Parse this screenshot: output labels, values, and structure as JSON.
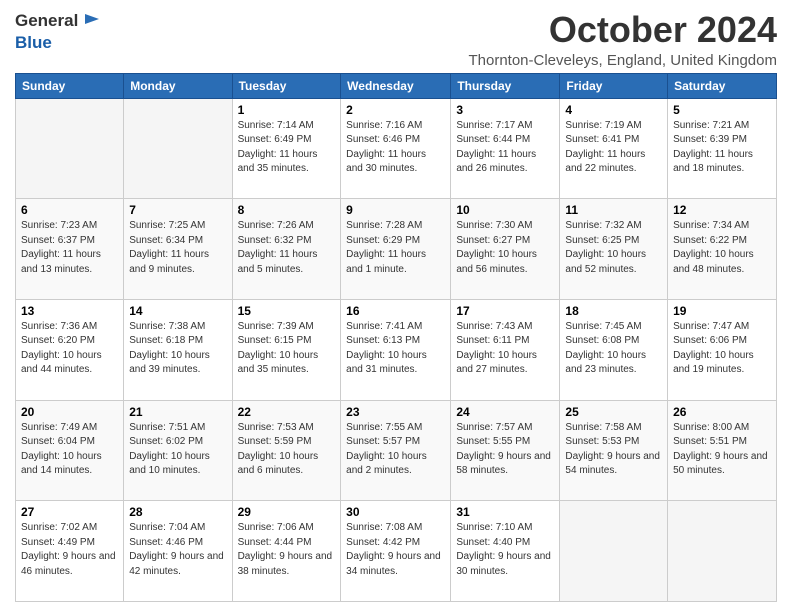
{
  "logo": {
    "line1": "General",
    "line2": "Blue"
  },
  "title": "October 2024",
  "location": "Thornton-Cleveleys, England, United Kingdom",
  "days_of_week": [
    "Sunday",
    "Monday",
    "Tuesday",
    "Wednesday",
    "Thursday",
    "Friday",
    "Saturday"
  ],
  "weeks": [
    [
      {
        "day": "",
        "info": ""
      },
      {
        "day": "",
        "info": ""
      },
      {
        "day": "1",
        "info": "Sunrise: 7:14 AM\nSunset: 6:49 PM\nDaylight: 11 hours and 35 minutes."
      },
      {
        "day": "2",
        "info": "Sunrise: 7:16 AM\nSunset: 6:46 PM\nDaylight: 11 hours and 30 minutes."
      },
      {
        "day": "3",
        "info": "Sunrise: 7:17 AM\nSunset: 6:44 PM\nDaylight: 11 hours and 26 minutes."
      },
      {
        "day": "4",
        "info": "Sunrise: 7:19 AM\nSunset: 6:41 PM\nDaylight: 11 hours and 22 minutes."
      },
      {
        "day": "5",
        "info": "Sunrise: 7:21 AM\nSunset: 6:39 PM\nDaylight: 11 hours and 18 minutes."
      }
    ],
    [
      {
        "day": "6",
        "info": "Sunrise: 7:23 AM\nSunset: 6:37 PM\nDaylight: 11 hours and 13 minutes."
      },
      {
        "day": "7",
        "info": "Sunrise: 7:25 AM\nSunset: 6:34 PM\nDaylight: 11 hours and 9 minutes."
      },
      {
        "day": "8",
        "info": "Sunrise: 7:26 AM\nSunset: 6:32 PM\nDaylight: 11 hours and 5 minutes."
      },
      {
        "day": "9",
        "info": "Sunrise: 7:28 AM\nSunset: 6:29 PM\nDaylight: 11 hours and 1 minute."
      },
      {
        "day": "10",
        "info": "Sunrise: 7:30 AM\nSunset: 6:27 PM\nDaylight: 10 hours and 56 minutes."
      },
      {
        "day": "11",
        "info": "Sunrise: 7:32 AM\nSunset: 6:25 PM\nDaylight: 10 hours and 52 minutes."
      },
      {
        "day": "12",
        "info": "Sunrise: 7:34 AM\nSunset: 6:22 PM\nDaylight: 10 hours and 48 minutes."
      }
    ],
    [
      {
        "day": "13",
        "info": "Sunrise: 7:36 AM\nSunset: 6:20 PM\nDaylight: 10 hours and 44 minutes."
      },
      {
        "day": "14",
        "info": "Sunrise: 7:38 AM\nSunset: 6:18 PM\nDaylight: 10 hours and 39 minutes."
      },
      {
        "day": "15",
        "info": "Sunrise: 7:39 AM\nSunset: 6:15 PM\nDaylight: 10 hours and 35 minutes."
      },
      {
        "day": "16",
        "info": "Sunrise: 7:41 AM\nSunset: 6:13 PM\nDaylight: 10 hours and 31 minutes."
      },
      {
        "day": "17",
        "info": "Sunrise: 7:43 AM\nSunset: 6:11 PM\nDaylight: 10 hours and 27 minutes."
      },
      {
        "day": "18",
        "info": "Sunrise: 7:45 AM\nSunset: 6:08 PM\nDaylight: 10 hours and 23 minutes."
      },
      {
        "day": "19",
        "info": "Sunrise: 7:47 AM\nSunset: 6:06 PM\nDaylight: 10 hours and 19 minutes."
      }
    ],
    [
      {
        "day": "20",
        "info": "Sunrise: 7:49 AM\nSunset: 6:04 PM\nDaylight: 10 hours and 14 minutes."
      },
      {
        "day": "21",
        "info": "Sunrise: 7:51 AM\nSunset: 6:02 PM\nDaylight: 10 hours and 10 minutes."
      },
      {
        "day": "22",
        "info": "Sunrise: 7:53 AM\nSunset: 5:59 PM\nDaylight: 10 hours and 6 minutes."
      },
      {
        "day": "23",
        "info": "Sunrise: 7:55 AM\nSunset: 5:57 PM\nDaylight: 10 hours and 2 minutes."
      },
      {
        "day": "24",
        "info": "Sunrise: 7:57 AM\nSunset: 5:55 PM\nDaylight: 9 hours and 58 minutes."
      },
      {
        "day": "25",
        "info": "Sunrise: 7:58 AM\nSunset: 5:53 PM\nDaylight: 9 hours and 54 minutes."
      },
      {
        "day": "26",
        "info": "Sunrise: 8:00 AM\nSunset: 5:51 PM\nDaylight: 9 hours and 50 minutes."
      }
    ],
    [
      {
        "day": "27",
        "info": "Sunrise: 7:02 AM\nSunset: 4:49 PM\nDaylight: 9 hours and 46 minutes."
      },
      {
        "day": "28",
        "info": "Sunrise: 7:04 AM\nSunset: 4:46 PM\nDaylight: 9 hours and 42 minutes."
      },
      {
        "day": "29",
        "info": "Sunrise: 7:06 AM\nSunset: 4:44 PM\nDaylight: 9 hours and 38 minutes."
      },
      {
        "day": "30",
        "info": "Sunrise: 7:08 AM\nSunset: 4:42 PM\nDaylight: 9 hours and 34 minutes."
      },
      {
        "day": "31",
        "info": "Sunrise: 7:10 AM\nSunset: 4:40 PM\nDaylight: 9 hours and 30 minutes."
      },
      {
        "day": "",
        "info": ""
      },
      {
        "day": "",
        "info": ""
      }
    ]
  ]
}
